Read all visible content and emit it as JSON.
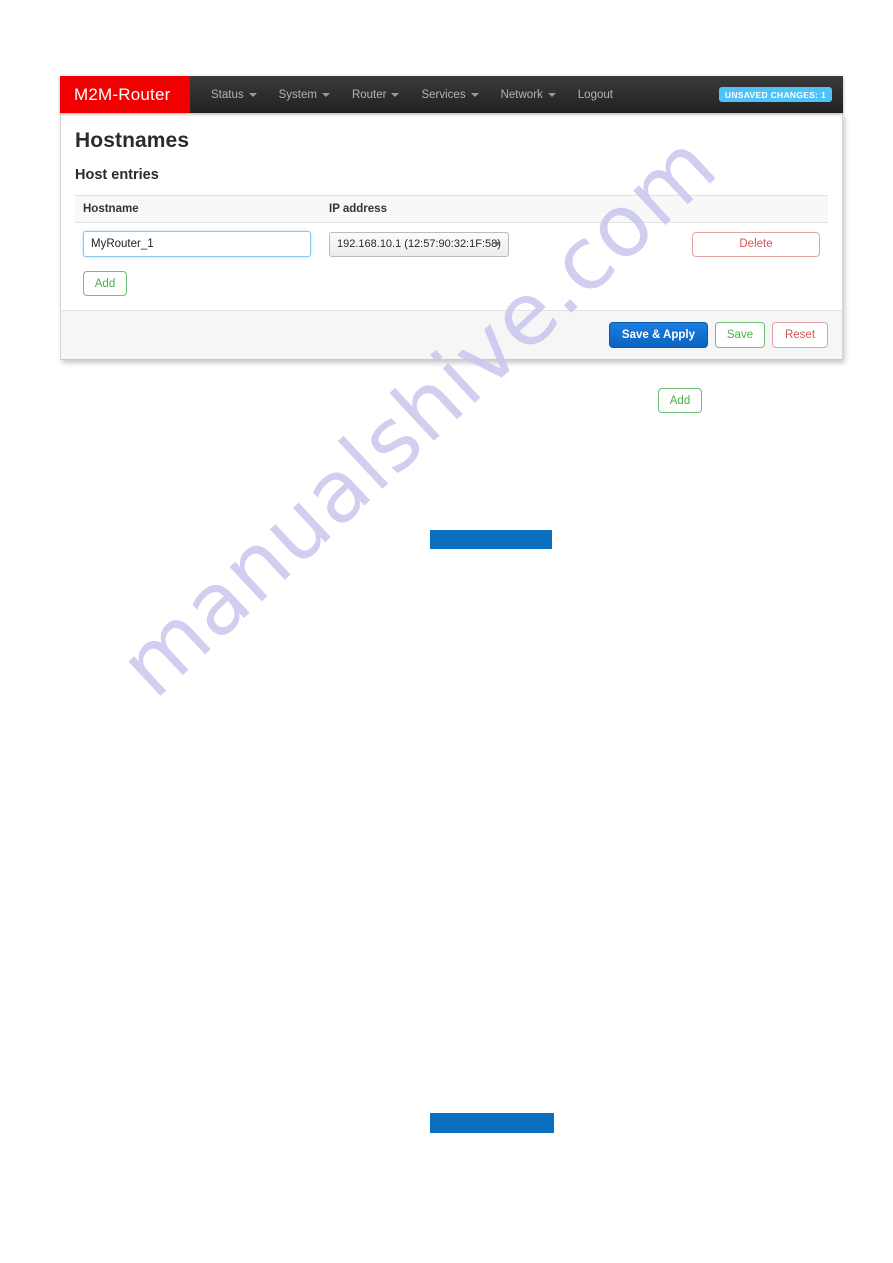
{
  "navbar": {
    "brand": "M2M-Router",
    "items": [
      {
        "label": "Status",
        "has_caret": true
      },
      {
        "label": "System",
        "has_caret": true
      },
      {
        "label": "Router",
        "has_caret": true
      },
      {
        "label": "Services",
        "has_caret": true
      },
      {
        "label": "Network",
        "has_caret": true
      },
      {
        "label": "Logout",
        "has_caret": false
      }
    ],
    "unsaved_badge": "UNSAVED CHANGES: 1",
    "brand_color": "#f00000",
    "bar_color": "#2b2b2b",
    "badge_color": "#4fc3f7"
  },
  "page": {
    "title": "Hostnames",
    "section_title": "Host entries"
  },
  "table": {
    "headers": {
      "hostname": "Hostname",
      "ip_address": "IP address"
    },
    "rows": [
      {
        "hostname_value": "MyRouter_1",
        "hostname_placeholder": "",
        "ip_selected": "192.168.10.1 (12:57:90:32:1F:58)",
        "delete_label": "Delete"
      }
    ],
    "add_label": "Add"
  },
  "footer": {
    "save_apply_label": "Save & Apply",
    "save_label": "Save",
    "reset_label": "Reset",
    "primary_color": "#0a6ed1",
    "save_color": "#4cae4c",
    "reset_color": "#d9534f"
  },
  "extras": {
    "floating_add_label": "Add",
    "redaction_color": "#0b6fbf"
  },
  "watermark": {
    "text": "manualshive.com",
    "color": "#c9c6ee"
  }
}
